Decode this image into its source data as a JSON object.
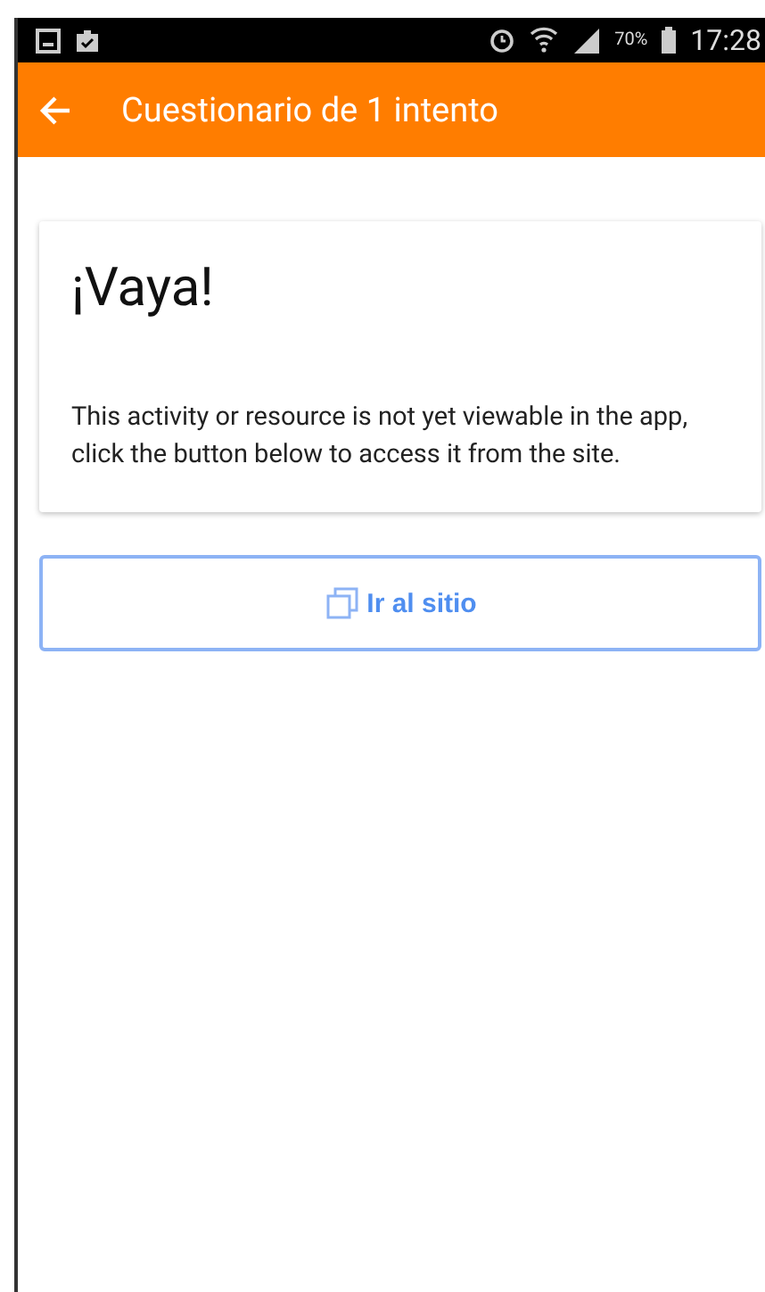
{
  "status_bar": {
    "battery": "70%",
    "time": "17:28"
  },
  "app_bar": {
    "title": "Cuestionario de 1 intento"
  },
  "card": {
    "heading": "¡Vaya!",
    "message": "This activity or resource is not yet viewable in the app, click the button below to access it from the site."
  },
  "button": {
    "label": "Ir al sitio"
  }
}
